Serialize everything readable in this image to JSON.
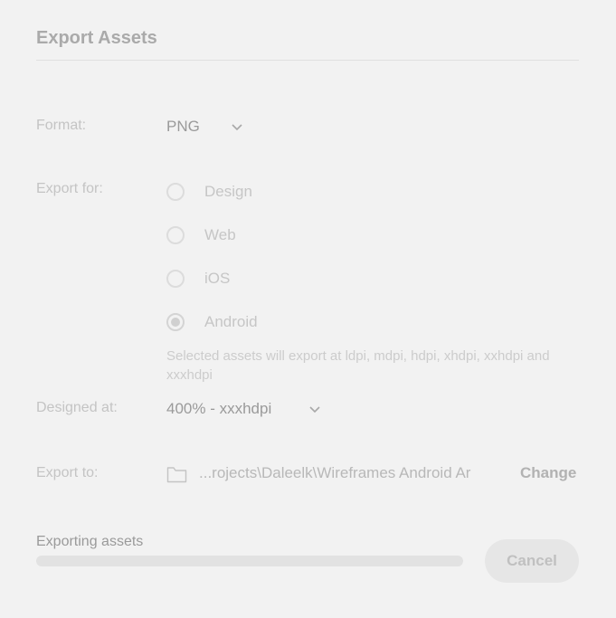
{
  "dialog": {
    "title": "Export Assets"
  },
  "format": {
    "label": "Format:",
    "value": "PNG",
    "icon": "chevron-down-icon"
  },
  "export_for": {
    "label": "Export for:",
    "options": [
      {
        "label": "Design",
        "checked": false
      },
      {
        "label": "Web",
        "checked": false
      },
      {
        "label": "iOS",
        "checked": false
      },
      {
        "label": "Android",
        "checked": true
      }
    ],
    "hint": "Selected assets will export at ldpi, mdpi, hdpi, xhdpi, xxhdpi and xxxhdpi"
  },
  "designed_at": {
    "label": "Designed at:",
    "value": "400% - xxxhdpi",
    "icon": "chevron-down-icon"
  },
  "export_to": {
    "label": "Export to:",
    "icon": "folder-icon",
    "path": "...rojects\\Daleelk\\Wireframes Android Ar",
    "change_label": "Change"
  },
  "progress": {
    "label": "Exporting assets",
    "fraction": 0.0
  },
  "footer": {
    "cancel_label": "Cancel"
  },
  "colors": {
    "background": "#f2f2f2",
    "muted_text": "#c4c4c4",
    "track": "#e2e2e2"
  }
}
